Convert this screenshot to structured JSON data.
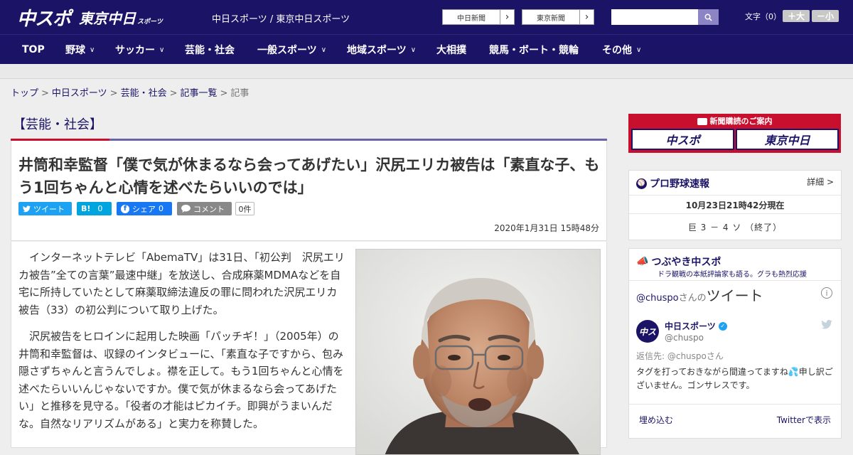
{
  "header": {
    "logo_main": "中スポ",
    "logo_sub": "東京中日",
    "logo_sub_small": "スポーツ",
    "site_links": "中日スポーツ / 東京中日スポーツ",
    "paper_buttons": [
      {
        "label": "中日新聞",
        "arrow": "›"
      },
      {
        "label": "東京新聞",
        "arrow": "›"
      }
    ],
    "search_placeholder": "",
    "font_size_label": "文字（0）",
    "font_larger": "＋大",
    "font_smaller": "－小"
  },
  "nav": {
    "items": [
      {
        "label": "TOP",
        "has_menu": false
      },
      {
        "label": "野球",
        "has_menu": true
      },
      {
        "label": "サッカー",
        "has_menu": true
      },
      {
        "label": "芸能・社会",
        "has_menu": false
      },
      {
        "label": "一般スポーツ",
        "has_menu": true
      },
      {
        "label": "地域スポーツ",
        "has_menu": true
      },
      {
        "label": "大相撲",
        "has_menu": false
      },
      {
        "label": "競馬・ボート・競輪",
        "has_menu": false
      },
      {
        "label": "その他",
        "has_menu": true
      }
    ]
  },
  "breadcrumb": {
    "items": [
      "トップ",
      "中日スポーツ",
      "芸能・社会",
      "記事一覧"
    ],
    "current": "記事",
    "separator": ">"
  },
  "article": {
    "category": "【芸能・社会】",
    "headline": "井筒和幸監督「僕で気が休まるなら会ってあげたい」沢尻エリカ被告は「素直な子、もう1回ちゃんと心情を述べたらいいのでは」",
    "share": {
      "tweet": "ツイート",
      "hatena": "B!",
      "hatena_count": "0",
      "facebook": "シェア",
      "facebook_count": "0",
      "comment": "コメント",
      "comment_count": "0件"
    },
    "date": "2020年1月31日 15時48分",
    "paragraphs": [
      "インターネットテレビ「AbemaTV」は31日、「初公判　沢尻エリカ被告”全ての言葉”最速中継」を放送し、合成麻薬MDMAなどを自宅に所持していたとして麻薬取締法違反の罪に問われた沢尻エリカ被告（33）の初公判について取り上げた。",
      "沢尻被告をヒロインに起用した映画「パッチギ！」（2005年）の井筒和幸監督は、収録のインタビューに、「素直な子ですから、包み隠さずちゃんと言うんでしょ。襟を正して。もう1回ちゃんと心情を述べたらいいんじゃないですか。僕で気が休まるなら会ってあげたい」と推移を見守る。「役者の才能はピカイチ。即興がうまいんだな。自然なリアリズムがある」と実力を称賛した。"
    ]
  },
  "sidebar": {
    "subscribe": {
      "title": "新聞購読のご案内",
      "btn1": "中スポ",
      "btn2": "東京中日"
    },
    "baseball": {
      "title": "プロ野球速報",
      "detail": "詳細 >",
      "datetime": "10月23日21時42分現在",
      "score": "巨 3 － 4 ソ （終了）"
    },
    "tweets": {
      "title": "つぶやき中スポ",
      "subtitle": "ドラ観戦の本紙評論家も語る。グラも熱烈応援",
      "handle_prefix": "@chuspo",
      "handle_suffix": "さんの",
      "heading": "ツイート",
      "author": "中日スポーツ",
      "author_handle": "@chuspo",
      "reply_to": "返信先: @chuspoさん",
      "text": "タグを打っておきながら間違ってますね💦申し訳ございません。ゴンサレスです。",
      "embed": "埋め込む",
      "view_on": "Twitterで表示"
    }
  },
  "colors": {
    "brand_navy": "#1b1466",
    "accent_red": "#c8102e",
    "twitter": "#1da1f2",
    "facebook": "#1877f2",
    "hatena": "#00a4de"
  }
}
